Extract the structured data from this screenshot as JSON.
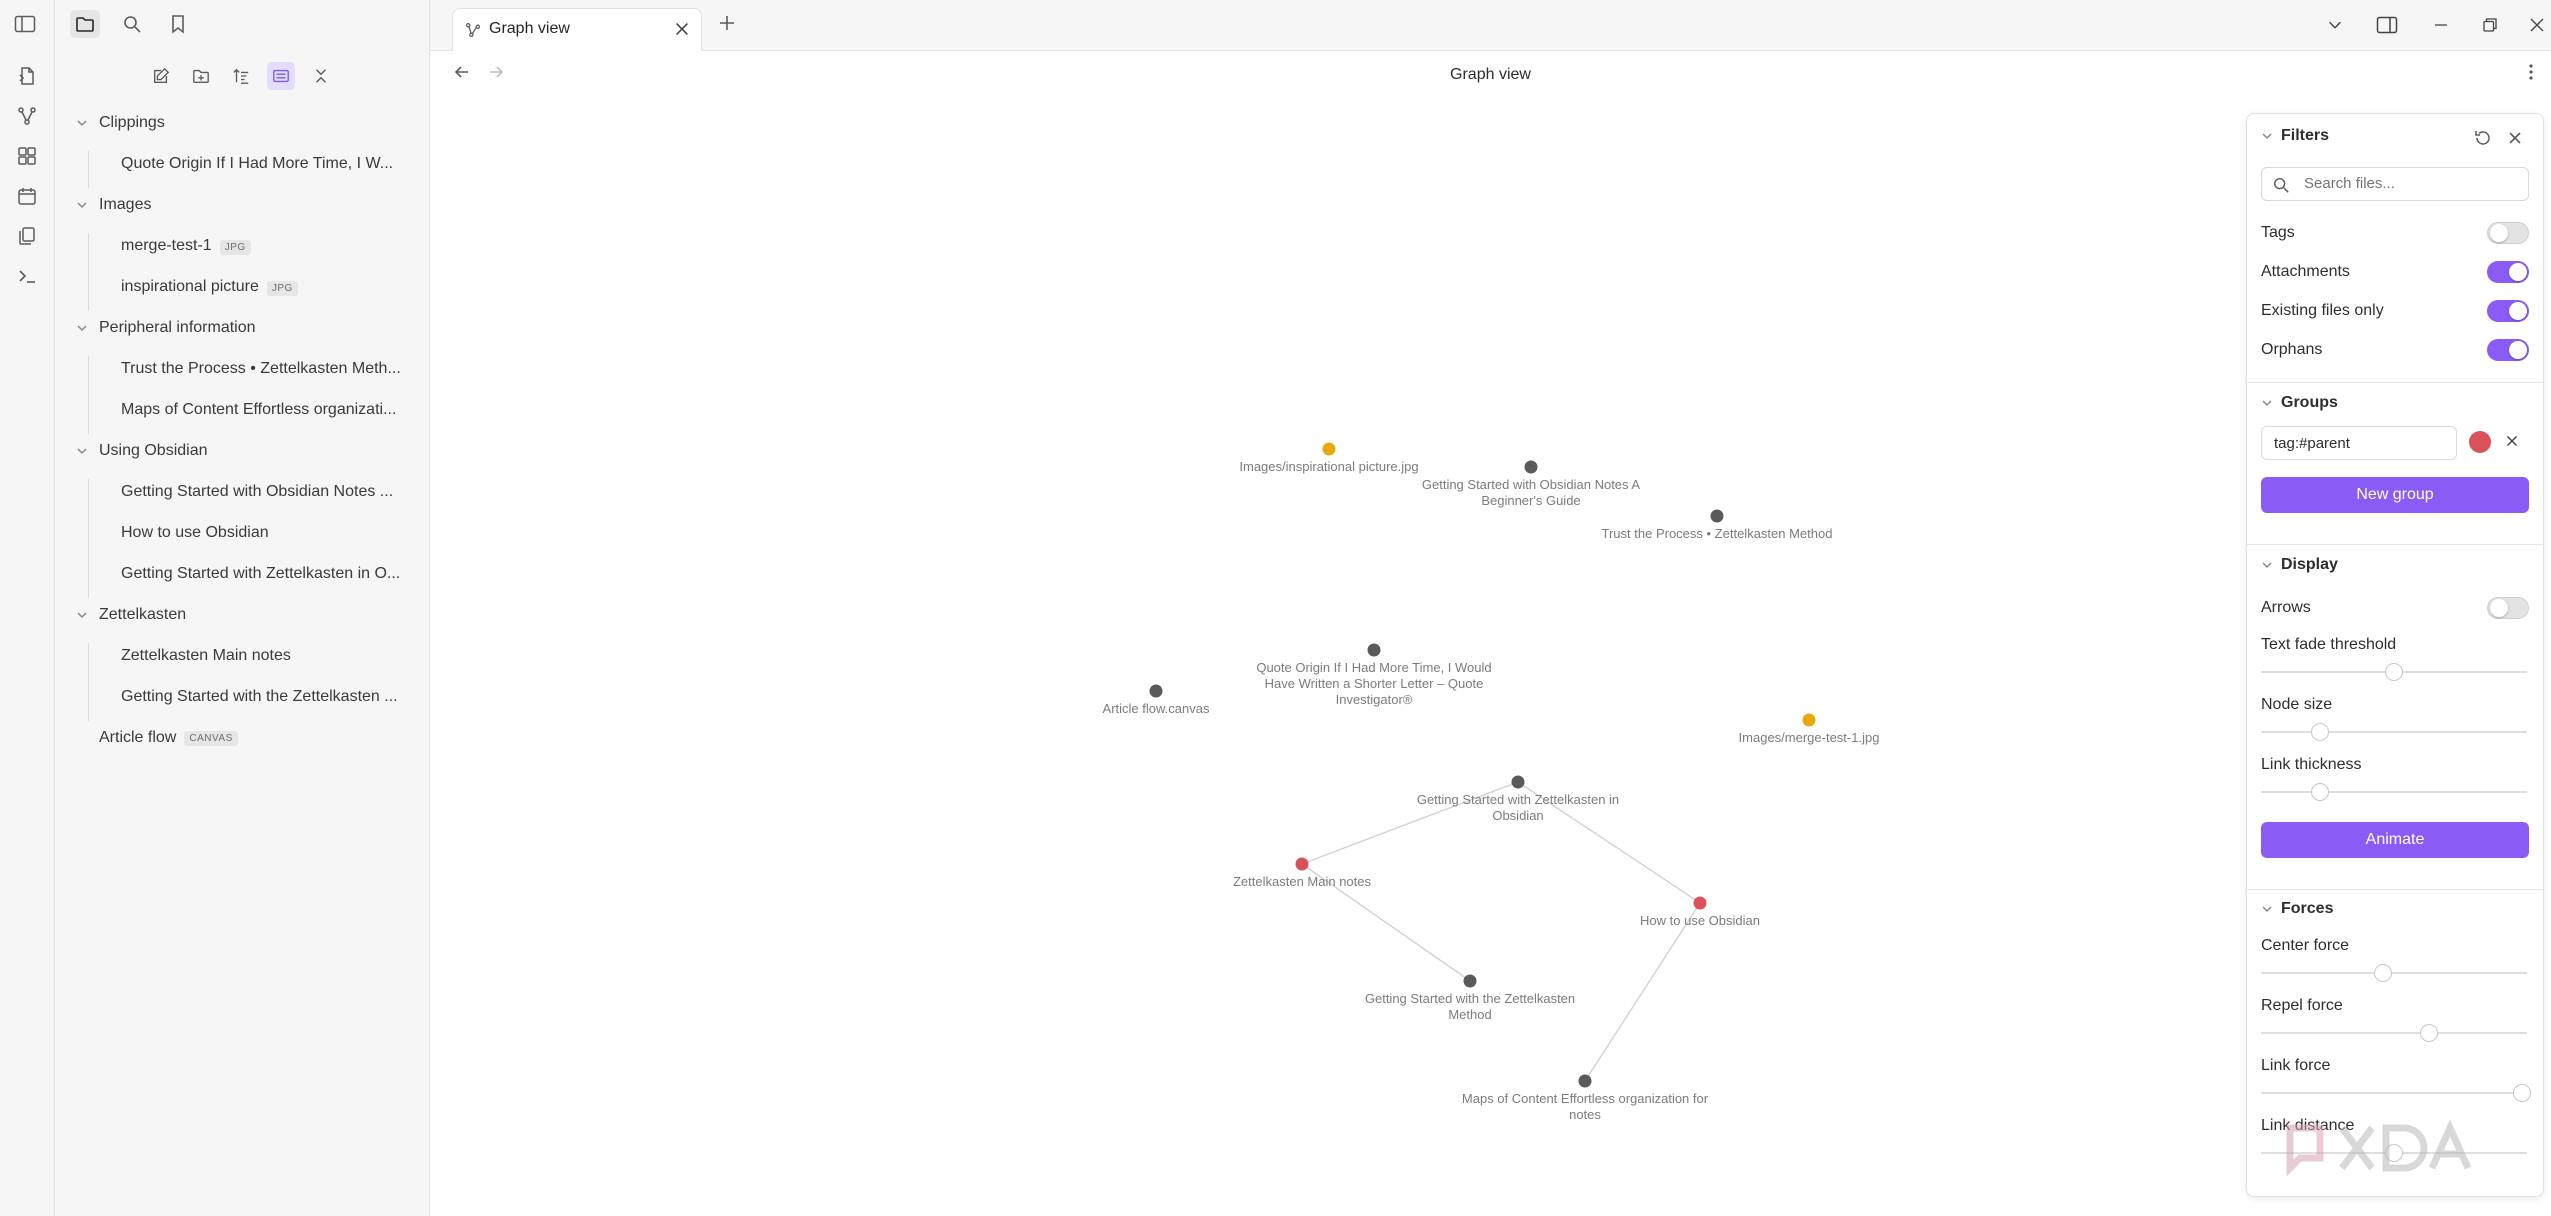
{
  "ribbon": {
    "buttons": [
      "open-quick-switcher-icon",
      "graph-view-icon",
      "canvas-icon",
      "daily-note-icon",
      "templates-icon",
      "command-palette-icon"
    ]
  },
  "sidebar": {
    "top_buttons": [
      "toggle-sidebar-icon",
      "files-icon",
      "search-icon",
      "bookmarks-icon"
    ],
    "nav_buttons": [
      "new-note-icon",
      "new-folder-icon",
      "sort-icon",
      "auto-reveal-icon",
      "collapse-all-icon"
    ],
    "tree": {
      "folders": [
        {
          "name": "Clippings",
          "files": [
            {
              "name": "Quote Origin If I Had More Time, I W..."
            }
          ]
        },
        {
          "name": "Images",
          "files": [
            {
              "name": "merge-test-1",
              "badge": "JPG"
            },
            {
              "name": "inspirational picture",
              "badge": "JPG"
            }
          ]
        },
        {
          "name": "Peripheral information",
          "files": [
            {
              "name": "Trust the Process • Zettelkasten Meth..."
            },
            {
              "name": "Maps of Content Effortless organizati..."
            }
          ]
        },
        {
          "name": "Using Obsidian",
          "files": [
            {
              "name": "Getting Started with Obsidian Notes ..."
            },
            {
              "name": "How to use Obsidian"
            },
            {
              "name": "Getting Started with Zettelkasten in O..."
            }
          ]
        },
        {
          "name": "Zettelkasten",
          "files": [
            {
              "name": "Zettelkasten Main notes"
            },
            {
              "name": "Getting Started with the Zettelkasten ..."
            }
          ]
        }
      ],
      "root_files": [
        {
          "name": "Article flow",
          "badge": "CANVAS"
        }
      ]
    }
  },
  "tabs": {
    "active": {
      "title": "Graph view",
      "icon": "graph-icon"
    },
    "new_tab_icon": "plus-icon"
  },
  "view": {
    "title": "Graph view"
  },
  "graph": {
    "colors": {
      "default": "#5a5a5a",
      "attachment": "#e8a80a",
      "group": "#d9525b",
      "link": "#d2d2d2"
    },
    "nodes": [
      {
        "id": "img-insp",
        "label": "Images/inspirational picture.jpg",
        "kind": "attachment"
      },
      {
        "id": "gs-obs",
        "label": "Getting Started with Obsidian Notes A Beginner's Guide",
        "kind": "default"
      },
      {
        "id": "trust",
        "label": "Trust the Process • Zettelkasten Method",
        "kind": "default"
      },
      {
        "id": "quote",
        "label": "Quote Origin If I Had More Time, I Would Have Written a Shorter Letter – Quote Investigator®",
        "kind": "default"
      },
      {
        "id": "article",
        "label": "Article flow.canvas",
        "kind": "default"
      },
      {
        "id": "img-merge",
        "label": "Images/merge-test-1.jpg",
        "kind": "attachment"
      },
      {
        "id": "gs-zk-obs",
        "label": "Getting Started with Zettelkasten in Obsidian",
        "kind": "default"
      },
      {
        "id": "zk-main",
        "label": "Zettelkasten Main notes",
        "kind": "group"
      },
      {
        "id": "how-obs",
        "label": "How to use Obsidian",
        "kind": "group"
      },
      {
        "id": "gs-zk",
        "label": "Getting Started with the Zettelkasten Method",
        "kind": "default"
      },
      {
        "id": "maps",
        "label": "Maps of Content Effortless organization for notes",
        "kind": "default"
      }
    ],
    "links": [
      [
        "gs-zk-obs",
        "zk-main"
      ],
      [
        "gs-zk-obs",
        "how-obs"
      ],
      [
        "zk-main",
        "gs-zk"
      ],
      [
        "how-obs",
        "maps"
      ]
    ]
  },
  "panel": {
    "filters": {
      "title": "Filters",
      "search_placeholder": "Search files...",
      "toggles": [
        {
          "label": "Tags",
          "on": false
        },
        {
          "label": "Attachments",
          "on": true
        },
        {
          "label": "Existing files only",
          "on": true
        },
        {
          "label": "Orphans",
          "on": true
        }
      ]
    },
    "groups": {
      "title": "Groups",
      "items": [
        {
          "query": "tag:#parent",
          "color": "#d9525b"
        }
      ],
      "new_group_label": "New group"
    },
    "display": {
      "title": "Display",
      "arrows_label": "Arrows",
      "arrows_on": false,
      "sliders": [
        {
          "label": "Text fade threshold",
          "value": 0.5
        },
        {
          "label": "Node size",
          "value": 0.22
        },
        {
          "label": "Link thickness",
          "value": 0.22
        }
      ],
      "animate_label": "Animate"
    },
    "forces": {
      "title": "Forces",
      "sliders": [
        {
          "label": "Center force",
          "value": 0.46
        },
        {
          "label": "Repel force",
          "value": 0.63
        },
        {
          "label": "Link force",
          "value": 0.98
        },
        {
          "label": "Link distance",
          "value": 0.5
        }
      ]
    }
  },
  "accent": "#8a5cf5"
}
